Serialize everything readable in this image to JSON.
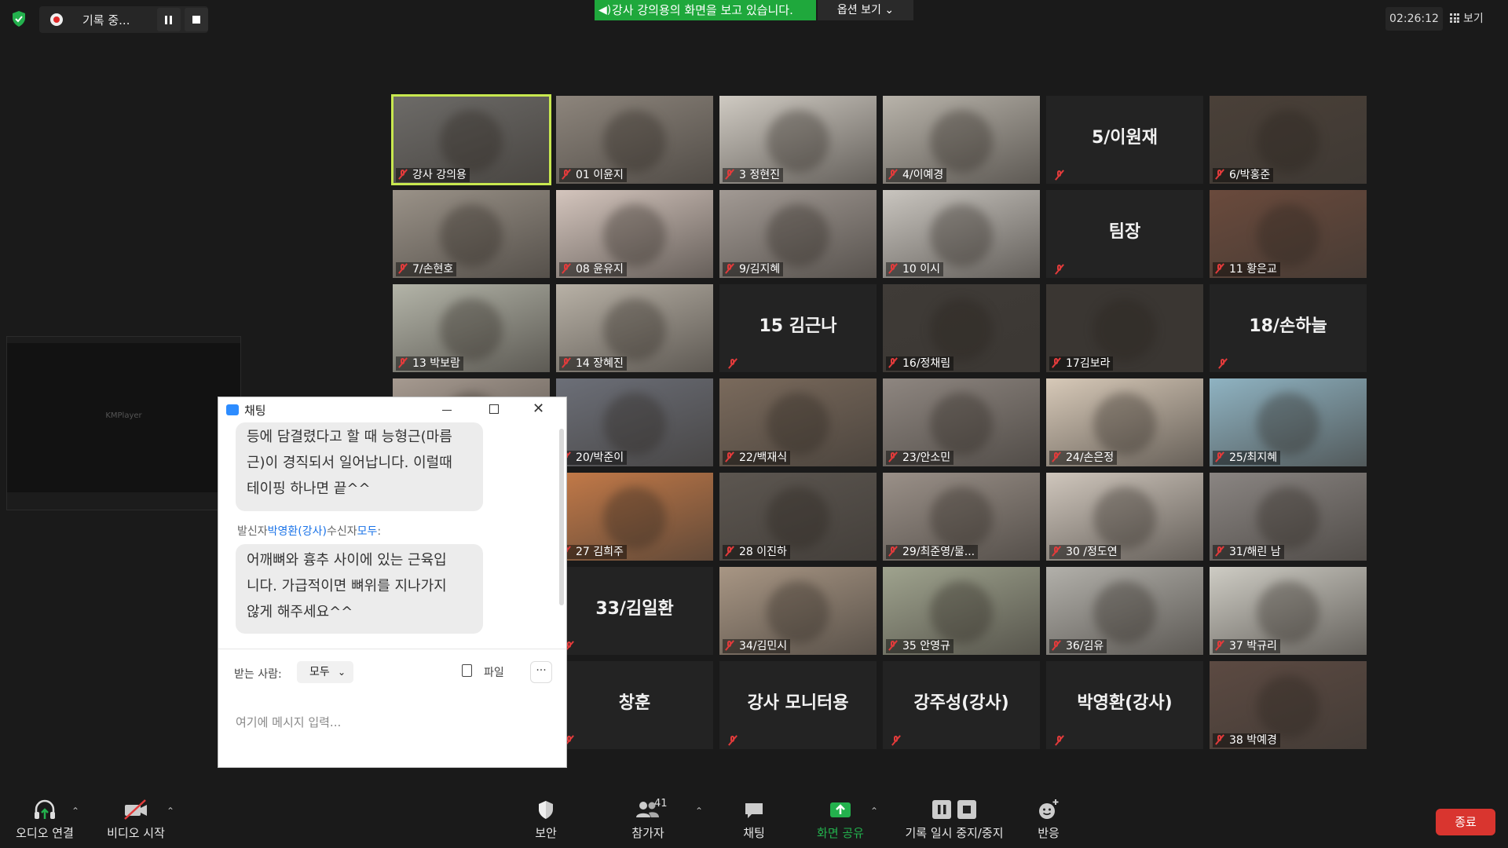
{
  "recording": {
    "label": "기록 중..."
  },
  "share_banner": {
    "text": "강사 강의용의 화면을 보고 있습니다.",
    "view_options": "옵션 보기 ⌄"
  },
  "timer": "02:26:12",
  "view_button": "보기",
  "kmplayer": {
    "label": "KMPlayer"
  },
  "participants": [
    {
      "name": "강사 강의용",
      "video": true,
      "bg": "#6d6b68",
      "active": true
    },
    {
      "name": "01 이윤지",
      "video": true,
      "bg": "#8d857c"
    },
    {
      "name": "3 정현진",
      "video": true,
      "bg": "#cfcac2"
    },
    {
      "name": "4/이예경",
      "video": true,
      "bg": "#b8b3aa"
    },
    {
      "name": "5/이원재",
      "video": false
    },
    {
      "name": "6/박홍준",
      "video": true,
      "bg": "#4a4038"
    },
    {
      "name": "7/손현호",
      "video": true,
      "bg": "#9a9288"
    },
    {
      "name": "08 윤유지",
      "video": true,
      "bg": "#d4c5bd"
    },
    {
      "name": "9/김지혜",
      "video": true,
      "bg": "#a29a94"
    },
    {
      "name": "10 이시",
      "video": true,
      "bg": "#c9c5bf"
    },
    {
      "name": "팀장",
      "video": false
    },
    {
      "name": "11 황은교",
      "video": true,
      "bg": "#6a4a3c"
    },
    {
      "name": "13 박보람",
      "video": true,
      "bg": "#b3b4a8"
    },
    {
      "name": "14 장혜진",
      "video": true,
      "bg": "#b8b1a6"
    },
    {
      "name": "15 김근나",
      "video": false
    },
    {
      "name": "16/정채림",
      "video": true,
      "bg": "#3f3b37"
    },
    {
      "name": "17김보라",
      "video": true,
      "bg": "#3a3632"
    },
    {
      "name": "18/손하늘",
      "video": false
    },
    {
      "name": "",
      "video": true,
      "bg": "#a69a90"
    },
    {
      "name": "20/박준이",
      "video": true,
      "bg": "#6c6f78"
    },
    {
      "name": "22/백재식",
      "video": true,
      "bg": "#7a6a5c"
    },
    {
      "name": "23/안소민",
      "video": true,
      "bg": "#8e8680"
    },
    {
      "name": "24/손은정",
      "video": true,
      "bg": "#d7c9b8"
    },
    {
      "name": "25/최지혜",
      "video": true,
      "bg": "#8fb3c2"
    },
    {
      "name": "",
      "video": true,
      "bg": "#2c2c2c"
    },
    {
      "name": "27 김희주",
      "video": true,
      "bg": "#c47a48"
    },
    {
      "name": "28 이진하",
      "video": true,
      "bg": "#5c5650"
    },
    {
      "name": "29/최준영/물...",
      "video": true,
      "bg": "#9a9088"
    },
    {
      "name": "30 /정도연",
      "video": true,
      "bg": "#cfc6bc"
    },
    {
      "name": "31/해린 남",
      "video": true,
      "bg": "#8a8582"
    },
    {
      "name": "",
      "video": true,
      "bg": "#2c2c2c"
    },
    {
      "name": "33/김일환",
      "video": false
    },
    {
      "name": "34/김민시",
      "video": true,
      "bg": "#a89684"
    },
    {
      "name": "35 안영규",
      "video": true,
      "bg": "#9fa38e"
    },
    {
      "name": "36/김유",
      "video": true,
      "bg": "#b2b0aa"
    },
    {
      "name": "37 박규리",
      "video": true,
      "bg": "#ceccc4"
    },
    {
      "name": "창훈",
      "video": false
    },
    {
      "name": "강사 모니터용",
      "video": false
    },
    {
      "name": "강주성(강사)",
      "video": false
    },
    {
      "name": "박영환(강사)",
      "video": false
    },
    {
      "name": "38 박예경",
      "video": true,
      "bg": "#5c4a42"
    }
  ],
  "chat": {
    "title": "채팅",
    "messages": [
      {
        "text": "등에 담결렸다고 할 때 능형근(마름\n근)이 경직되서 일어납니다. 이럴때\n테이핑 하나면 끝^^"
      },
      {
        "text": "어깨뼈와 흉추 사이에 있는 근육입\n니다. 가급적이면 뼈위를 지나가지\n않게 해주세요^^"
      }
    ],
    "sender_prefix": "발신자",
    "sender_name": "박영환(강사)",
    "recipient_prefix": "수신자",
    "recipient_name": "모두",
    "sender_suffix": ":",
    "to_label": "받는 사람:",
    "to_value": "모두",
    "file_label": "파일",
    "more": "···",
    "input_placeholder": "여기에 메시지 입력..."
  },
  "toolbar": {
    "audio": "오디오 연결",
    "video": "비디오 시작",
    "security": "보안",
    "participants": "참가자",
    "participants_count": "41",
    "chat": "채팅",
    "share": "화면 공유",
    "record": "기록 일시 중지/중지",
    "reactions": "반응",
    "end": "종료"
  }
}
